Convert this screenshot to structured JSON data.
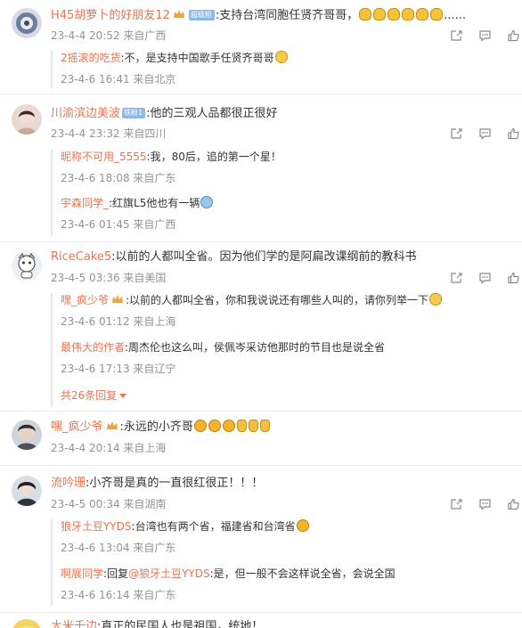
{
  "comments": [
    {
      "username": "H45胡萝卜的好朋友12",
      "badge": "超级粉",
      "text": ":支持台湾同胞任贤齐哥哥，",
      "text_tail": "......",
      "meta": "23-4-4 20:52 来自广西",
      "replies": [
        {
          "username": "2摇滚的吃货",
          "text": ":不，是支持中国歌手任贤齐哥哥",
          "meta": "23-4-6 16:41 来自北京"
        }
      ]
    },
    {
      "username": "川渝滨边美波",
      "badge": "铁粉1",
      "text": ":他的三观人品都很正很好",
      "meta": "23-4-4 23:32 来自四川",
      "replies": [
        {
          "username": "昵称不可用_5555",
          "text": ":我，80后，追的第一个星！",
          "meta": "23-4-6 18:08 来自广东"
        },
        {
          "username": "宇森同学_",
          "text": ":红旗L5他也有一辆",
          "meta": "23-4-6 01:45 来自广西"
        }
      ]
    },
    {
      "username": "RiceCake5",
      "text": ":以前的人都叫全省。因为他们学的是阿扁改课纲前的教科书",
      "meta": "23-4-5 03:36 来自美国",
      "replies": [
        {
          "username": "嘿_疯少爷",
          "text": ":以前的人都叫全省，你和我说说还有哪些人叫的，请你列举一下",
          "meta": "23-4-6 01:12 来自上海"
        },
        {
          "username": "最伟大的作者",
          "text": ":周杰伦也这么叫，侯佩岑采访他那时的节目也是说全省",
          "meta": "23-4-6 17:13 来自辽宁"
        }
      ],
      "more": "共26条回复"
    },
    {
      "username": "嘿_疯少爷",
      "text": ":永远的小齐哥",
      "meta": "23-4-4 20:14 来自上海",
      "replies": []
    },
    {
      "username": "流吟珊",
      "text": ":小齐哥是真的一直很红很正！！！",
      "meta": "23-4-5 00:34 来自湖南",
      "replies": [
        {
          "username": "狼牙土豆YYDS",
          "text": ":台湾也有两个省，福建省和台湾省",
          "meta": "23-4-6 13:04 来自广东"
        },
        {
          "username": "啊展同学",
          "text": ":回复",
          "mention": "@狼牙土豆YYDS",
          "text_after": ":是，但一般不会这样说全省，会说全国",
          "meta": "23-4-6 16:14 来自广东"
        }
      ]
    },
    {
      "username": "大米千边",
      "text": ":真正的民国人也是祖国，统地！",
      "meta": "",
      "replies": []
    }
  ],
  "colors": {
    "username": "#eb7350",
    "meta": "#939393",
    "text": "#333333",
    "badge": "#8fb7e9"
  }
}
